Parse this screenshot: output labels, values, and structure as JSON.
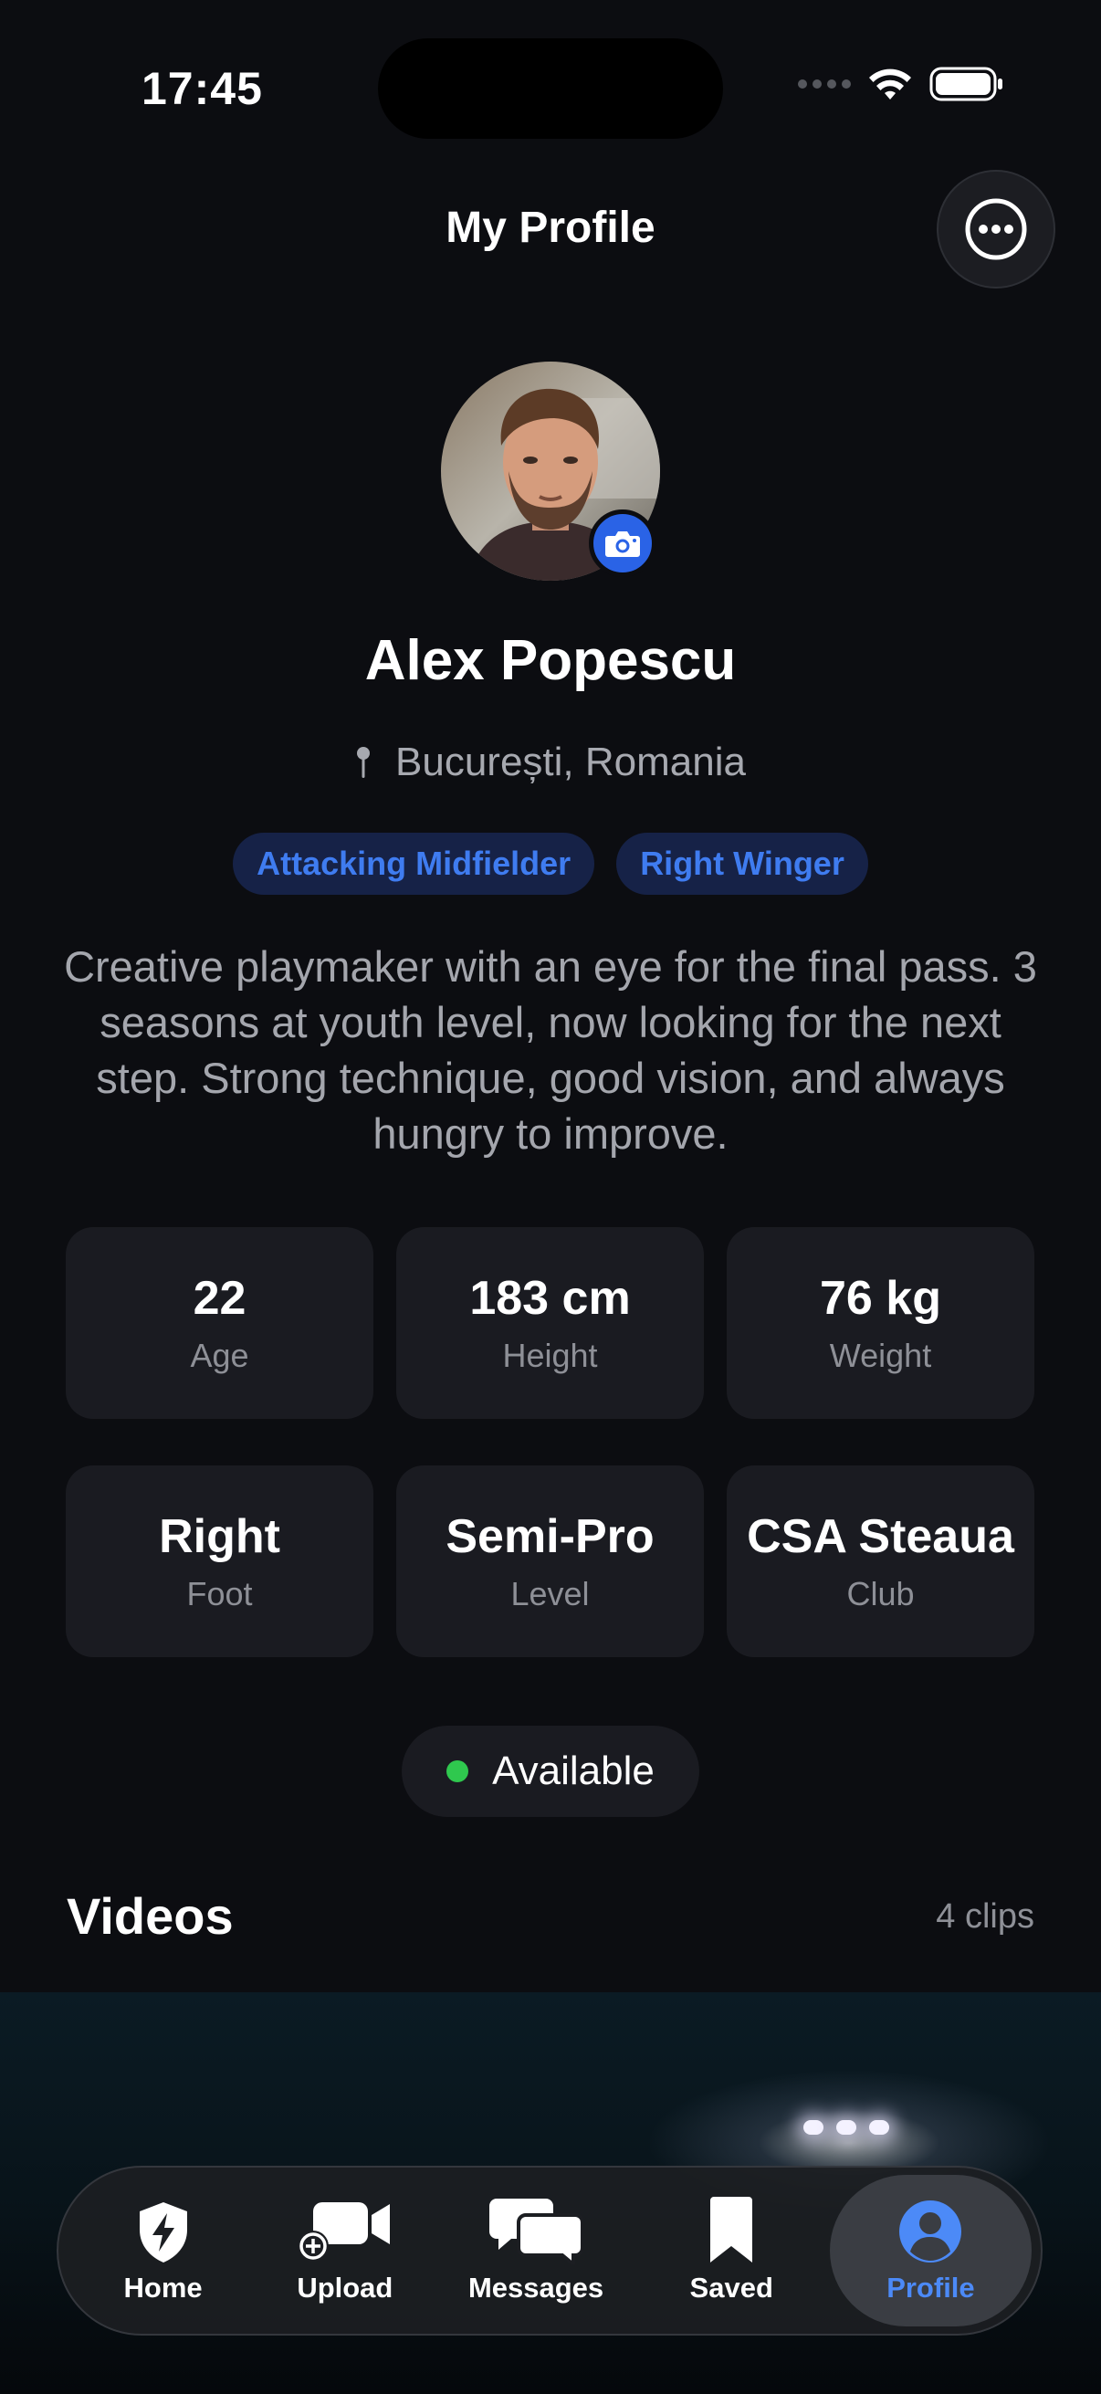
{
  "status_bar": {
    "time": "17:45"
  },
  "header": {
    "title": "My Profile",
    "more_icon": "ellipsis-circle-icon"
  },
  "profile": {
    "name": "Alex Popescu",
    "location": "București, Romania",
    "positions": [
      "Attacking Midfielder",
      "Right Winger"
    ],
    "bio": "Creative playmaker with an eye for the final pass. 3 seasons at youth level, now looking for the next step. Strong technique, good vision, and always hungry to improve.",
    "stats": [
      {
        "value": "22",
        "label": "Age"
      },
      {
        "value": "183 cm",
        "label": "Height"
      },
      {
        "value": "76 kg",
        "label": "Weight"
      },
      {
        "value": "Right",
        "label": "Foot"
      },
      {
        "value": "Semi-Pro",
        "label": "Level"
      },
      {
        "value": "CSA Steaua",
        "label": "Club"
      }
    ],
    "availability": {
      "label": "Available",
      "color": "#2fc84e"
    }
  },
  "videos": {
    "title": "Videos",
    "count": "4 clips"
  },
  "tab_bar": {
    "items": [
      {
        "label": "Home",
        "icon": "shield-bolt-icon"
      },
      {
        "label": "Upload",
        "icon": "video-plus-icon"
      },
      {
        "label": "Messages",
        "icon": "chat-bubbles-icon"
      },
      {
        "label": "Saved",
        "icon": "bookmark-icon"
      },
      {
        "label": "Profile",
        "icon": "person-circle-icon",
        "active": true
      }
    ],
    "active_color": "#4c8af7"
  },
  "colors": {
    "accent": "#2a63e6",
    "tag_text": "#3f7cf0",
    "background": "#0c0d11"
  }
}
